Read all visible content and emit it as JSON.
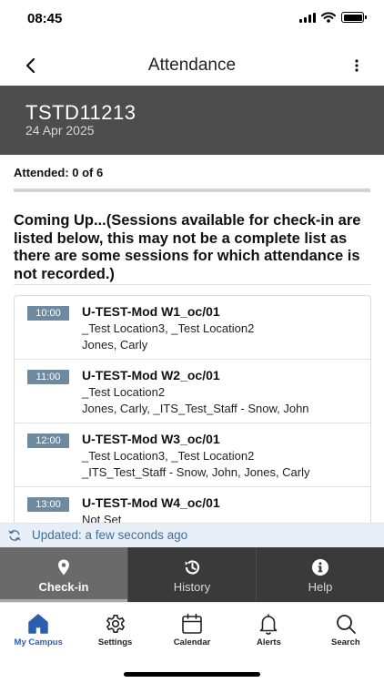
{
  "status_bar": {
    "time": "08:45"
  },
  "nav": {
    "title": "Attendance",
    "back_icon": "chevron-left-icon",
    "more_icon": "more-vertical-icon"
  },
  "header": {
    "code": "TSTD11213",
    "date": "24 Apr 2025"
  },
  "attended_text": "Attended: 0 of 6",
  "coming_up_text": "Coming Up...(Sessions available for check-in are listed below, this may not be a complete list as there are some sessions for which attendance is not recorded.)",
  "sessions": [
    {
      "time": "10:00",
      "title": "U-TEST-Mod W1_oc/01",
      "location": "_Test Location3, _Test Location2",
      "staff": "Jones, Carly"
    },
    {
      "time": "11:00",
      "title": "U-TEST-Mod W2_oc/01",
      "location": "_Test Location2",
      "staff": "Jones, Carly, _ITS_Test_Staff - Snow, John"
    },
    {
      "time": "12:00",
      "title": "U-TEST-Mod W3_oc/01",
      "location": "_Test Location3, _Test Location2",
      "staff": "_ITS_Test_Staff - Snow, John, Jones, Carly"
    },
    {
      "time": "13:00",
      "title": "U-TEST-Mod W4_oc/01",
      "location": "Not  Set",
      "staff": ""
    }
  ],
  "updated": {
    "text": "Updated: a few seconds ago",
    "icon": "refresh-icon"
  },
  "section_tabs": [
    {
      "label": "Check-in",
      "icon": "location-pin-icon",
      "active": true
    },
    {
      "label": "History",
      "icon": "history-icon",
      "active": false
    },
    {
      "label": "Help",
      "icon": "info-icon",
      "active": false
    }
  ],
  "bottom_nav": [
    {
      "label": "My Campus",
      "icon": "home-icon",
      "active": true
    },
    {
      "label": "Settings",
      "icon": "gear-icon",
      "active": false
    },
    {
      "label": "Calendar",
      "icon": "calendar-icon",
      "active": false
    },
    {
      "label": "Alerts",
      "icon": "bell-icon",
      "active": false
    },
    {
      "label": "Search",
      "icon": "search-icon",
      "active": false
    }
  ],
  "colors": {
    "header_bg": "#4d4d4d",
    "badge": "#6e8aa0",
    "accent": "#2b5fae",
    "updated_bg": "#e8eef5",
    "tabs_bg": "#3a3a3a",
    "tab_active": "#6a6a6a"
  }
}
